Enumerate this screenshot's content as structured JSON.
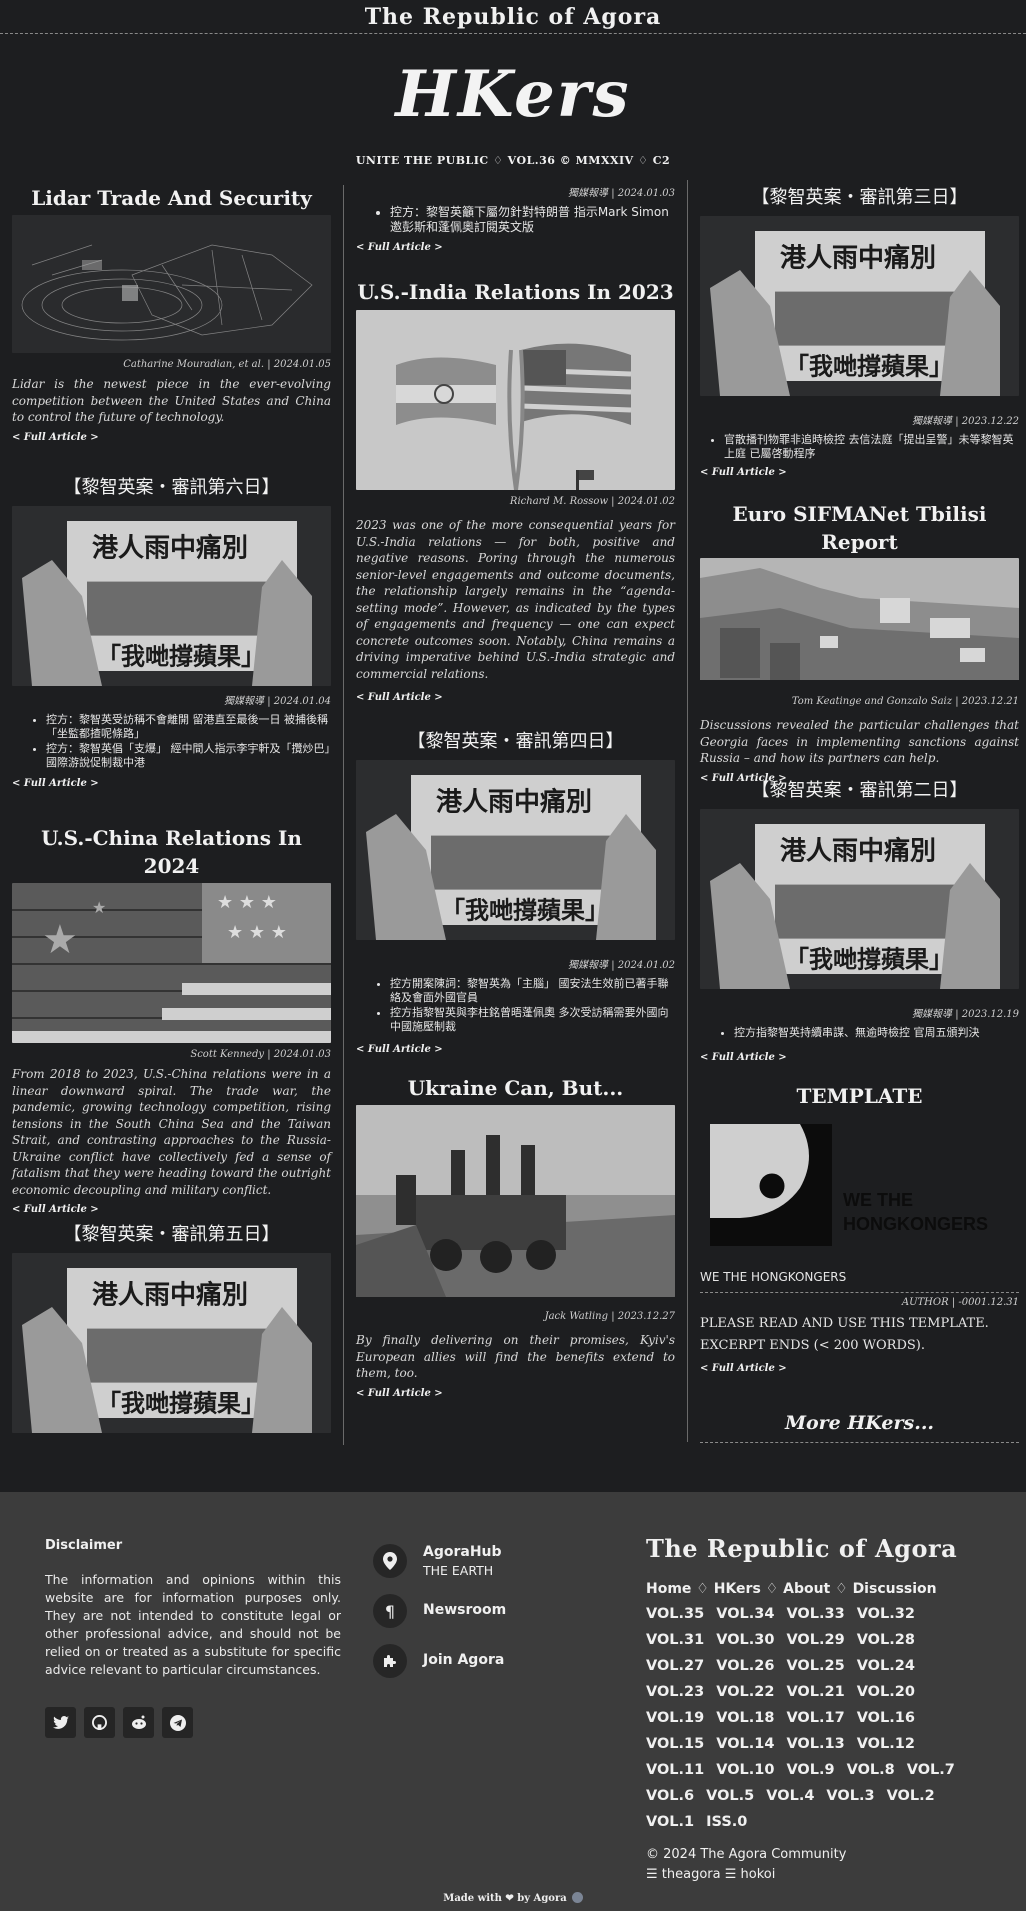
{
  "site": {
    "name": "The Republic of Agora",
    "logo": "HKers",
    "tagline": "UNITE THE PUBLIC ♢ VOL.36 © MMXXIV ♢ C2"
  },
  "more_label": "< Full Article >",
  "articles": {
    "lidar": {
      "title": "Lidar Trade And Security",
      "meta": "Catharine Mouradian, et al. | 2024.01.05",
      "excerpt": "Lidar is the newest piece in the ever-evolving competition between the United States and China to control the future of technology."
    },
    "day6": {
      "title": "【黎智英案・審訊第六日】",
      "meta": "獨媒報導 | 2024.01.04",
      "bullets": [
        "控方：黎智英受訪稱不會離開 留港直至最後一日 被捕後稱「坐監都揸呢條路」",
        "控方：黎智英倡「支爆」 經中間人指示李宇軒及「攬炒巴」國際游說促制裁中港"
      ]
    },
    "uschina": {
      "title": "U.S.-China Relations In 2024",
      "meta": "Scott Kennedy | 2024.01.03",
      "excerpt": "From 2018 to 2023, U.S.-China relations were in a linear downward spiral. The trade war, the pandemic, growing technology competition, rising tensions in the South China Sea and the Taiwan Strait, and contrasting approaches to the Russia-Ukraine conflict have collectively fed a sense of fatalism that they were heading toward the outright economic decoupling and military conflict."
    },
    "day5": {
      "title": "【黎智英案・審訊第五日】",
      "meta": "獨媒報導 | 2024.01.03",
      "bullets": [
        "控方：黎智英籲下屬勿針對特朗普 指示Mark Simon邀彭斯和蓬佩奧訂閱英文版"
      ]
    },
    "usindia": {
      "title": "U.S.-India Relations In 2023",
      "meta": "Richard M. Rossow | 2024.01.02",
      "excerpt": "2023 was one of the more consequential years for U.S.-India relations — for both, positive and negative reasons. Poring through the numerous senior-level engagements and outcome documents, the relationship largely remains in the “agenda-setting mode”. However, as indicated by the types of engagements and frequency — one can expect concrete outcomes soon. Notably, China remains a driving imperative behind U.S.-India strategic and commercial relations."
    },
    "day4": {
      "title": "【黎智英案・審訊第四日】",
      "meta": "獨媒報導 | 2024.01.02",
      "bullets": [
        "控方開案陳詞：黎智英為「主腦」 國安法生效前已著手聯絡及會面外國官員",
        "控方指黎智英與李柱銘曾晤蓬佩奧 多次受訪稱需要外國向中國施壓制裁"
      ]
    },
    "ukraine": {
      "title": "Ukraine Can, But...",
      "meta": "Jack Watling | 2023.12.27",
      "excerpt": "By finally delivering on their promises, Kyiv's European allies will find the benefits extend to them, too."
    },
    "day3": {
      "title": "【黎智英案・審訊第三日】",
      "meta": "獨媒報導 | 2023.12.22",
      "bullets": [
        "官散播刊物罪非追時檢控 去信法庭「提出呈警」未等黎智英上庭 已屬啓動程序"
      ]
    },
    "euro": {
      "title": "Euro SIFMANet Tbilisi Report",
      "meta": "Tom Keatinge and Gonzalo Saiz | 2023.12.21",
      "excerpt": "Discussions revealed the particular challenges that Georgia faces in implementing sanctions against Russia – and how its partners can help."
    },
    "day2": {
      "title": "【黎智英案・審訊第二日】",
      "meta": "獨媒報導 | 2023.12.19",
      "bullets": [
        "控方指黎智英持續串謀、無逾時檢控 官周五頒判決"
      ]
    },
    "template": {
      "title": "TEMPLATE",
      "img_text_1": "WE THE",
      "img_text_2": "HONGKONGERS",
      "caption": "WE THE HONGKONGERS",
      "meta": "AUTHOR | -0001.12.31",
      "line1": "PLEASE READ AND USE THIS TEMPLATE.",
      "line2": "EXCERPT ENDS (< 200 WORDS)."
    }
  },
  "newspaper_headline_1": "港人雨中痛別",
  "newspaper_headline_2": "「我哋撐蘋果」",
  "more_hkers": "More HKers...",
  "footer": {
    "disclaimer_title": "Disclaimer",
    "disclaimer_text": "The information and opinions within this website are for information purposes only. They are not intended to constitute legal or other professional advice, and should not be relied on or treated as a substitute for specific advice relevant to particular circumstances.",
    "contact": [
      {
        "icon": "map-pin-icon",
        "title": "AgoraHub",
        "sub": "THE EARTH"
      },
      {
        "icon": "pilcrow-icon",
        "title": "Newsroom",
        "sub": ""
      },
      {
        "icon": "puzzle-icon",
        "title": "Join Agora",
        "sub": ""
      }
    ],
    "site": "The Republic of Agora",
    "nav": [
      "Home",
      "HKers",
      "About",
      "Discussion"
    ],
    "nav_sep": "♢",
    "vols": [
      "VOL.35",
      "VOL.34",
      "VOL.33",
      "VOL.32",
      "VOL.31",
      "VOL.30",
      "VOL.29",
      "VOL.28",
      "VOL.27",
      "VOL.26",
      "VOL.25",
      "VOL.24",
      "VOL.23",
      "VOL.22",
      "VOL.21",
      "VOL.20",
      "VOL.19",
      "VOL.18",
      "VOL.17",
      "VOL.16",
      "VOL.15",
      "VOL.14",
      "VOL.13",
      "VOL.12",
      "VOL.11",
      "VOL.10",
      "VOL.9",
      "VOL.8",
      "VOL.7",
      "VOL.6",
      "VOL.5",
      "VOL.4",
      "VOL.3",
      "VOL.2",
      "VOL.1",
      "ISS.0"
    ],
    "copyright": "© 2024 The Agora Community",
    "credits": "☰ theagora ☰ hokoi",
    "made_with": "Made with ❤ by Agora"
  },
  "social_icons": [
    "twitter-icon",
    "github-icon",
    "reddit-icon",
    "telegram-icon"
  ]
}
